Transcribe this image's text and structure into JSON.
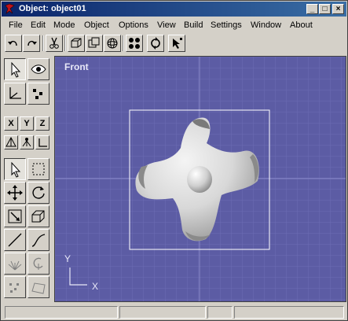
{
  "window": {
    "title": "Object: object01"
  },
  "controls": {
    "minimize": "_",
    "maximize": "□",
    "close": "×"
  },
  "menu": [
    "File",
    "Edit",
    "Mode",
    "Object",
    "Options",
    "View",
    "Build",
    "Settings",
    "Window",
    "About"
  ],
  "toolbar": {
    "buttons": [
      "undo-icon",
      "redo-icon",
      "scissors-icon",
      "box-view-icon",
      "copy-view-icon",
      "sphere-view-icon",
      "four-dots-icon",
      "rotate-view-icon",
      "select-points-icon"
    ]
  },
  "axes_lock": {
    "x": "X",
    "y": "Y",
    "z": "Z"
  },
  "viewport": {
    "label": "Front",
    "axis_y": "Y",
    "axis_x": "X",
    "background": "#5c5ca4",
    "grid_color": "#6c6cb4"
  },
  "palette": {
    "buttons": [
      "arrow-icon",
      "eye-icon",
      "axis-icon",
      "points-icon",
      "select-icon",
      "marquee-icon",
      "move-icon",
      "rotate-icon",
      "scale-icon",
      "scale-3d-icon",
      "line-icon",
      "curve-icon",
      "spray-icon",
      "twist-icon",
      "dots-icon",
      "plane-icon"
    ]
  }
}
